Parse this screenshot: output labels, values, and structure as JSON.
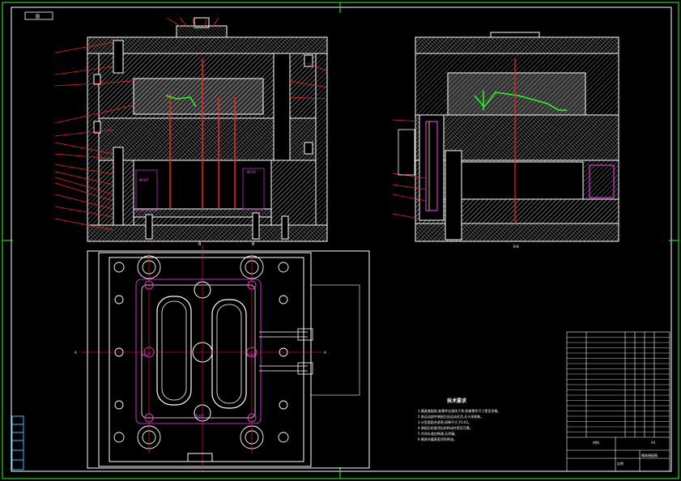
{
  "drawing": {
    "corner_tag": "图"
  },
  "section_labels": {
    "a_left": "A",
    "a_right": "A",
    "b_top": "B",
    "b_bottom": "B",
    "bb": "B-B"
  },
  "tech_requirements": {
    "title": "技术要求",
    "lines": [
      "1.模具装配前,各零件应清洗干净,检查零件尺寸是否合格。",
      "2.各运动部件装配后应运动灵活,无卡滞现象。",
      "3.分型面贴合紧密,间隙不大于0.02。",
      "4.装配后检查顶出机构动作是否可靠。",
      "5.冷却水道应畅通,无渗漏。",
      "6.模具外露表面涂防锈油。"
    ]
  },
  "title_block": {
    "name": "模具装配图",
    "mark": "A3",
    "material": "材料",
    "scale": "比例"
  },
  "colors": {
    "white": "#ffffff",
    "red": "#ff2020",
    "green": "#20ff20",
    "magenta": "#ff3cff",
    "yellow": "#ffff30",
    "cyan": "#30c0ff"
  }
}
